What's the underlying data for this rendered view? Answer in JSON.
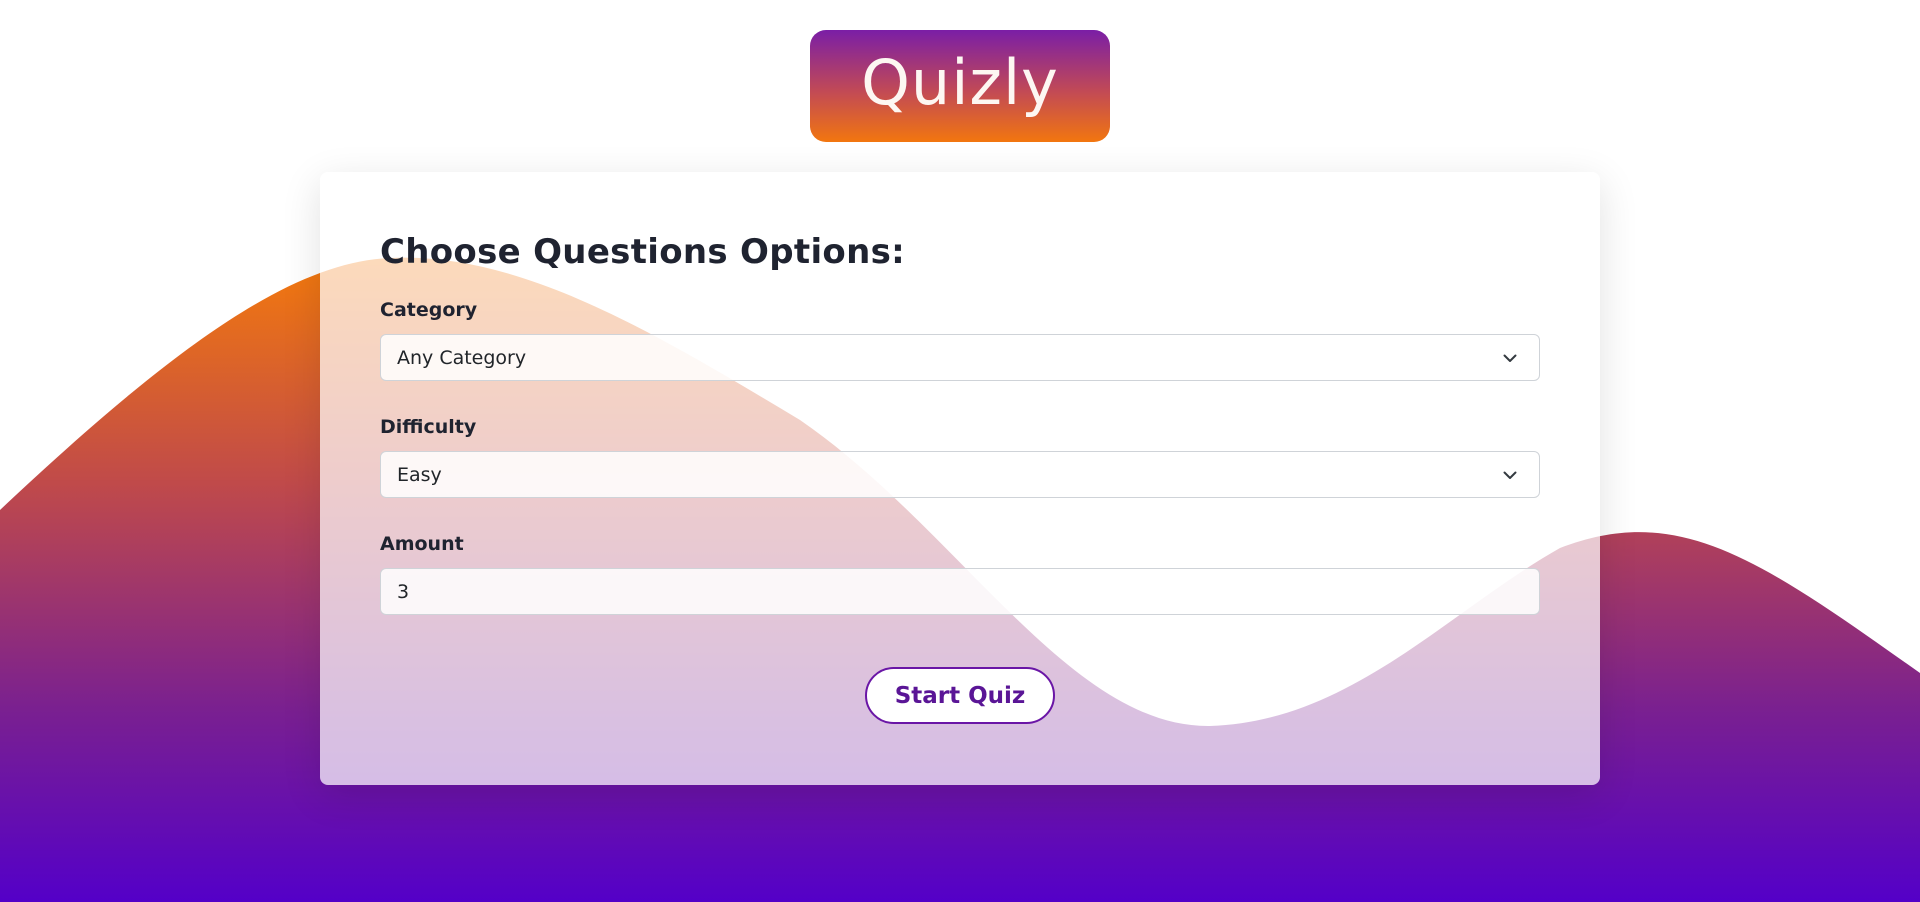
{
  "app": {
    "logo_text": "Quizly"
  },
  "form": {
    "title": "Choose Questions Options:",
    "category": {
      "label": "Category",
      "value": "Any Category"
    },
    "difficulty": {
      "label": "Difficulty",
      "value": "Easy"
    },
    "amount": {
      "label": "Amount",
      "value": "3"
    },
    "start_button_label": "Start Quiz"
  },
  "icons": {
    "category_chevron": "chevron-down-icon",
    "difficulty_chevron": "chevron-down-icon"
  },
  "colors": {
    "gradient_top": "#f47a0c",
    "gradient_bottom": "#5400c8",
    "accent": "#6a16a6",
    "title_text": "#1f2330"
  }
}
